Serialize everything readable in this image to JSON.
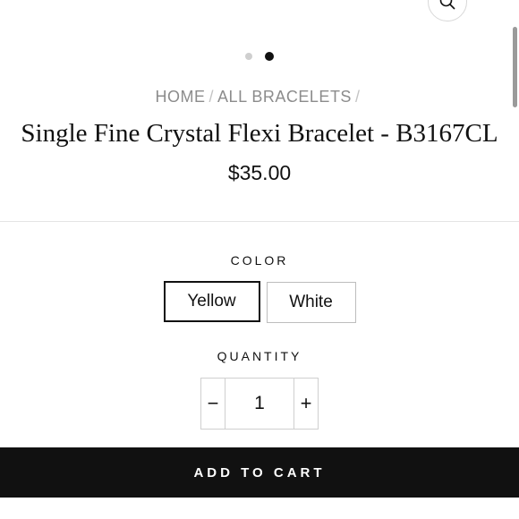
{
  "carousel": {
    "slide_count": 2,
    "active_index": 1
  },
  "breadcrumb": {
    "home": "HOME",
    "collection": "ALL BRACELETS",
    "separator": "/"
  },
  "product": {
    "title": "Single Fine Crystal Flexi Bracelet - B3167CL",
    "price": "$35.00"
  },
  "options": {
    "color_label": "COLOR",
    "colors": [
      "Yellow",
      "White"
    ],
    "selected_color": "Yellow"
  },
  "quantity": {
    "label": "QUANTITY",
    "value": "1",
    "minus": "−",
    "plus": "+"
  },
  "actions": {
    "add_to_cart": "ADD TO CART"
  },
  "icons": {
    "zoom": "search-icon"
  }
}
